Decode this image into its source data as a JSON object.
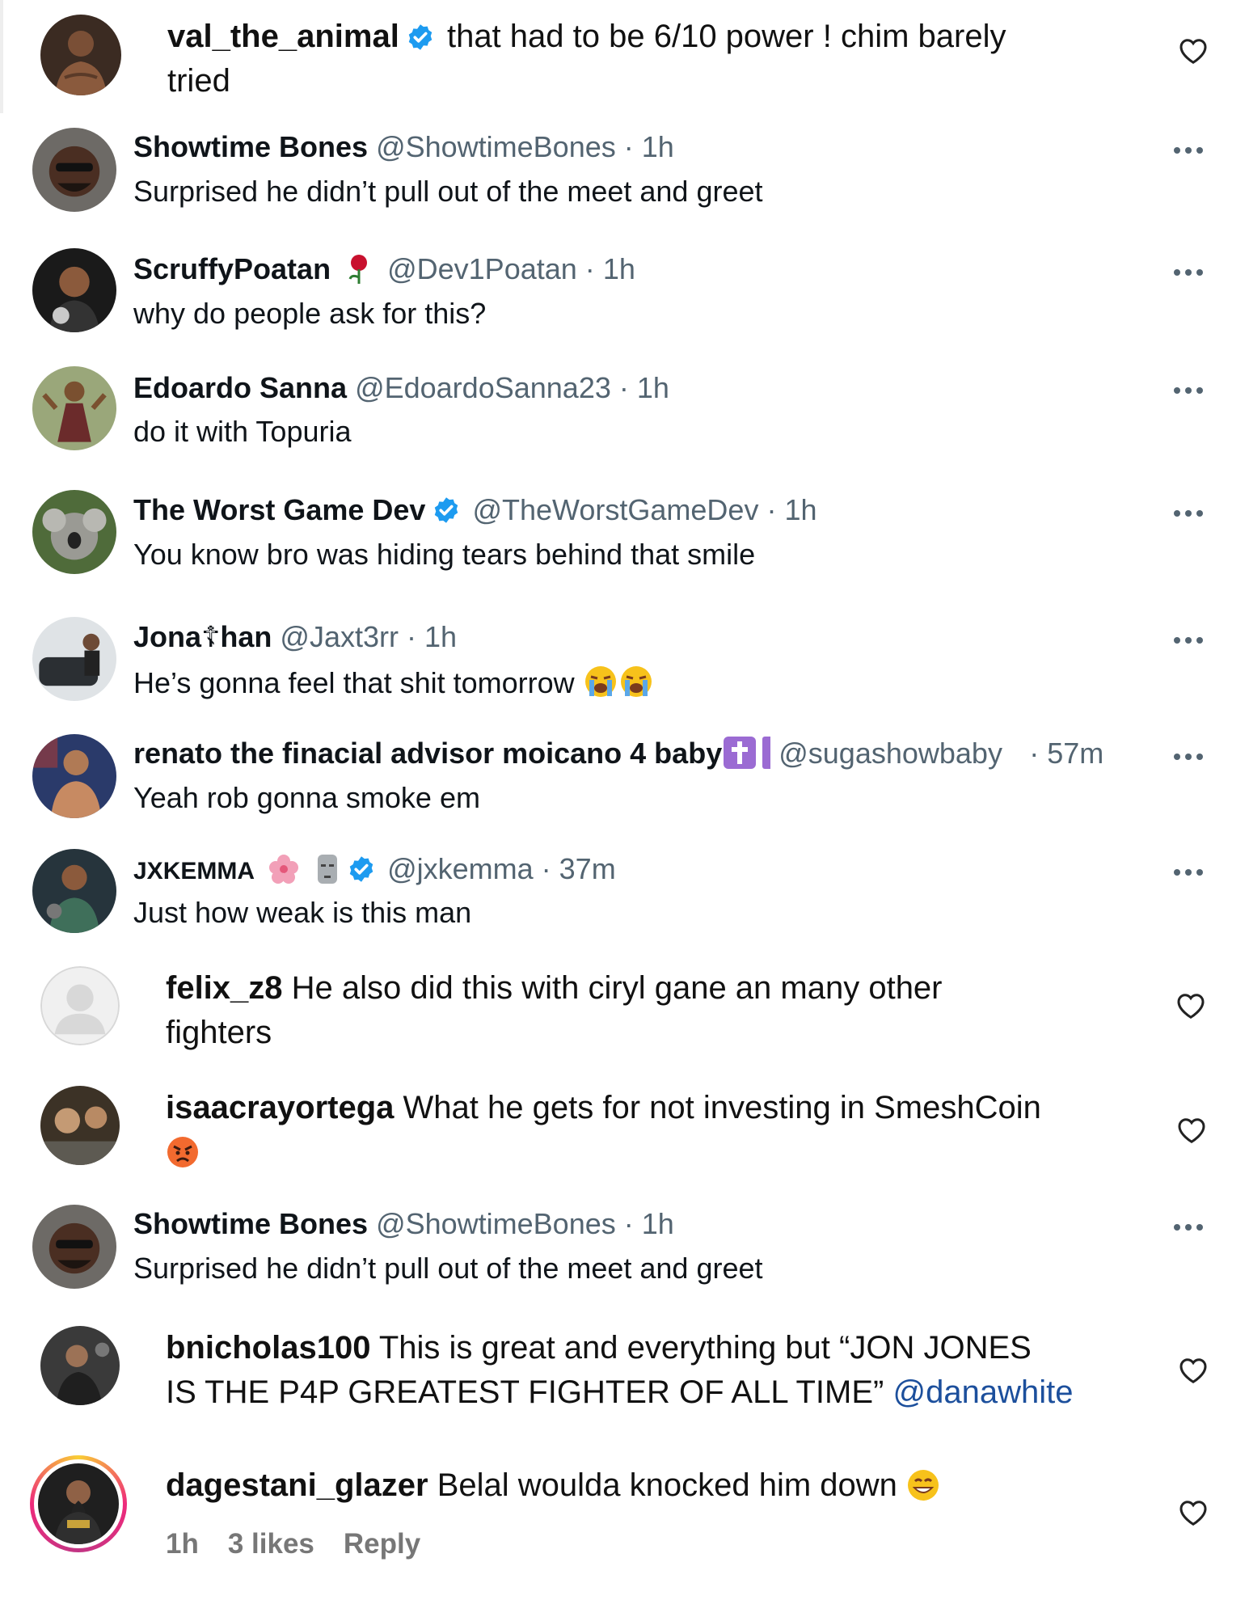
{
  "comments": [
    {
      "kind": "instagram",
      "username": "val_the_animal",
      "verified": true,
      "text": "that had to be 6/10 power ! chim barely",
      "text_line2": "tried"
    },
    {
      "kind": "twitter",
      "name": "Showtime Bones",
      "handle": "@ShowtimeBones",
      "sep": "·",
      "time": "1h",
      "text": "Surprised he didn’t pull out of the meet and greet"
    },
    {
      "kind": "twitter",
      "name": "ScruffyPoatan",
      "name_emoji": "rose",
      "handle": "@Dev1Poatan",
      "sep": "·",
      "time": "1h",
      "text": "why do people ask for this?"
    },
    {
      "kind": "twitter",
      "name": "Edoardo Sanna",
      "handle": "@EdoardoSanna23",
      "sep": "·",
      "time": "1h",
      "text": "do it with Topuria"
    },
    {
      "kind": "twitter",
      "name": "The Worst Game Dev",
      "verified": true,
      "handle": "@TheWorstGameDev",
      "sep": "·",
      "time": "1h",
      "text": "You know bro was hiding tears behind that smile"
    },
    {
      "kind": "twitter",
      "name": "Jona☦han",
      "handle": "@Jaxt3rr",
      "sep": "·",
      "time": "1h",
      "text": "He’s gonna feel that shit tomorrow",
      "text_emoji": "loudly-crying-face x2"
    },
    {
      "kind": "twitter",
      "name": "renato the finacial advisor moicano 4 baby",
      "name_emoji": "latin-cross",
      "handle": "@sugashowbaby",
      "sep": "·",
      "time": "57m",
      "text": "Yeah rob gonna smoke em"
    },
    {
      "kind": "twitter",
      "name": "JXKEMMA",
      "name_emoji": "hibiscus moai",
      "verified": true,
      "handle": "@jxkemma",
      "sep": "·",
      "time": "37m",
      "text": "Just how weak is this man"
    },
    {
      "kind": "instagram",
      "username": "felix_z8",
      "text": "He also did this with ciryl gane an many other",
      "text_line2": "fighters",
      "avatar": "default"
    },
    {
      "kind": "instagram",
      "username": "isaacrayortega",
      "text": "What he gets for not investing in SmeshCoin",
      "text_emoji": "angry-face"
    },
    {
      "kind": "twitter",
      "name": "Showtime Bones",
      "handle": "@ShowtimeBones",
      "sep": "·",
      "time": "1h",
      "text": "Surprised he didn’t pull out of the meet and greet"
    },
    {
      "kind": "instagram",
      "username": "bnicholas100",
      "text": "This is great and everything but “JON JONES",
      "text_line2": "IS THE P4P GREATEST FIGHTER OF ALL TIME”",
      "mention": "@danawhite"
    },
    {
      "kind": "instagram",
      "username": "dagestani_glazer",
      "text": "Belal woulda knocked him down",
      "text_emoji": "grinning-face",
      "meta": {
        "time": "1h",
        "likes": "3 likes",
        "reply": "Reply"
      },
      "story_ring": true
    }
  ],
  "icons": {
    "like": "heart-outline-icon",
    "more": "more-horizontal-icon",
    "verified": "verified-badge-icon"
  },
  "colors": {
    "verified_blue": "#1d9bf0",
    "handle_gray": "#536471",
    "mention_blue": "#1c4f9c",
    "meta_gray": "#777777"
  }
}
